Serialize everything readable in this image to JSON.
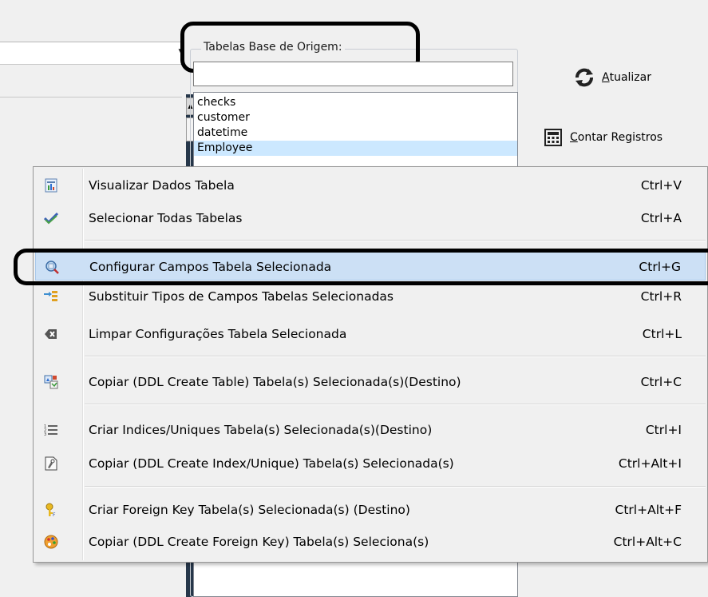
{
  "groupbox": {
    "title": "Tabelas Base de Origem:",
    "filter_value": ""
  },
  "table_list": {
    "items": [
      {
        "label": "checks"
      },
      {
        "label": "customer"
      },
      {
        "label": "datetime"
      },
      {
        "label": "Employee",
        "selected": true
      }
    ]
  },
  "right_panel": {
    "refresh": {
      "underlined": "A",
      "rest": "tualizar",
      "icon": "refresh-icon"
    },
    "count": {
      "underlined": "C",
      "rest": "ontar Registros",
      "icon": "calculator-icon"
    }
  },
  "context_menu": {
    "items": [
      {
        "label": "Visualizar Dados Tabela",
        "shortcut": "Ctrl+V",
        "icon": "view-table-icon"
      },
      {
        "label": "Selecionar Todas Tabelas",
        "shortcut": "Ctrl+A",
        "icon": "checkmark-icon"
      },
      {
        "label": "Configurar Campos Tabela Selecionada",
        "shortcut": "Ctrl+G",
        "icon": "configure-fields-icon",
        "highlighted": true
      },
      {
        "label": "Substituir Tipos de Campos Tabelas Selecionadas",
        "shortcut": "Ctrl+R",
        "icon": "replace-types-icon"
      },
      {
        "label": "Limpar Configurações Tabela Selecionada",
        "shortcut": "Ctrl+L",
        "icon": "clear-icon"
      },
      {
        "label": "Copiar (DDL Create Table) Tabela(s) Selecionada(s)(Destino)",
        "shortcut": "Ctrl+C",
        "icon": "copy-ddl-icon"
      },
      {
        "label": "Criar Indices/Uniques Tabela(s) Selecionada(s)(Destino)",
        "shortcut": "Ctrl+I",
        "icon": "numbered-list-icon"
      },
      {
        "label": "Copiar (DDL Create Index/Unique) Tabela(s) Selecionada(s)",
        "shortcut": "Ctrl+Alt+I",
        "icon": "copy-index-icon"
      },
      {
        "label": "Criar Foreign Key Tabela(s) Selecionada(s) (Destino)",
        "shortcut": "Ctrl+Alt+F",
        "icon": "foreign-key-icon"
      },
      {
        "label": "Copiar (DDL Create Foreign Key) Tabela(s) Seleciona(s)",
        "shortcut": "Ctrl+Alt+C",
        "icon": "palette-icon"
      }
    ]
  },
  "colors": {
    "menu_hover": "#cce0f5",
    "list_selected": "#cce8ff",
    "dark_bar": "#26374a",
    "annotation": "#000000"
  }
}
